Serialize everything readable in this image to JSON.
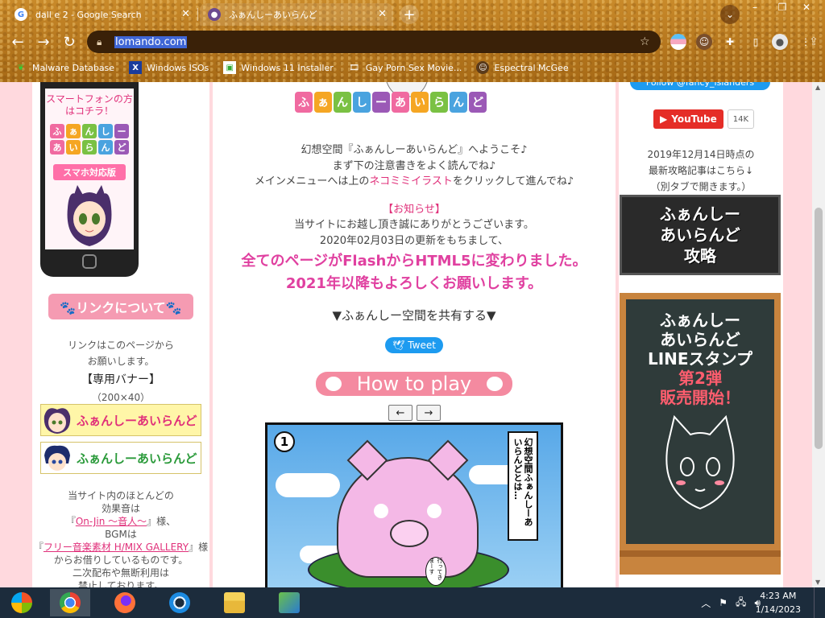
{
  "browser": {
    "tabs": [
      {
        "title": "dall e 2 - Google Search",
        "favicon": "google-icon",
        "active": false
      },
      {
        "title": "ふぁんしーあいらんど",
        "favicon": "cat-girl-icon",
        "active": true
      }
    ],
    "url": "lomando.com",
    "bookmarks": [
      {
        "label": "Malware Database",
        "icon": "leaf-icon"
      },
      {
        "label": "Windows ISOs",
        "icon": "x-icon"
      },
      {
        "label": "Windows 11 Installer",
        "icon": "image-icon"
      },
      {
        "label": "Gay Porn Sex Movie...",
        "icon": "film-icon"
      },
      {
        "label": "Espectral McGee",
        "icon": "person-icon"
      }
    ],
    "window_controls": {
      "minimize": "–",
      "maximize": "❐",
      "close": "✕"
    }
  },
  "left": {
    "phone_caption": "スマートフォンの方はコチラ！",
    "phone_logo_tiles": [
      "ふ",
      "ぁ",
      "ん",
      "し",
      "ー",
      "あ",
      "い",
      "ら",
      "ん",
      "ど"
    ],
    "phone_sp_label": "スマホ対応版",
    "link_button": "🐾リンクについて🐾",
    "link_text_1": "リンクはこのページから",
    "link_text_2": "お願いします。",
    "banner_title": "【専用バナー】",
    "banner_size": "（200×40）",
    "banner_text": "ふぁんしーあいらんど",
    "credit_1": "当サイト内のほとんどの",
    "credit_2": "効果音は",
    "credit_3a": "『",
    "credit_3_link": "On-Jin ～音人～",
    "credit_3b": "』様、",
    "credit_4": "BGMは",
    "credit_5a": "『",
    "credit_5_link": "フリー音楽素材 H/MIX GALLERY",
    "credit_5b": "』様",
    "credit_6": "からお借りしているものです。",
    "credit_7": "二次配布や無断利用は",
    "credit_8": "禁止しております。"
  },
  "main": {
    "logo_tiles": [
      "ふ",
      "ぁ",
      "ん",
      "し",
      "ー",
      "あ",
      "い",
      "ら",
      "ん",
      "ど"
    ],
    "intro_1": "幻想空間『ふぁんしーあいらんど』へようこそ♪",
    "intro_2": "まず下の注意書きをよく読んでね♪",
    "intro_3a": "メインメニューへは上の",
    "intro_3_link": "ネコミミイラスト",
    "intro_3b": "をクリックして進んでね♪",
    "notice_title": "【お知らせ】",
    "notice_1": "当サイトにお越し頂き誠にありがとうございます。",
    "notice_2": "2020年02月03日の更新をもちまして、",
    "big_1": "全てのページがFlashからHTML5に変わりました。",
    "big_2": "2021年以降もよろしくお願いします。",
    "share_text": "▼ふぁんしー空間を共有する▼",
    "tweet_label": "Tweet",
    "howto_label": "How to play",
    "prev_label": "←",
    "next_label": "→",
    "comic": {
      "panel_number": "1",
      "bubble_text": "幻想空間ふぁんしーあいらんどとは…",
      "small_bubble": "行ってきまーす"
    }
  },
  "right": {
    "follow_label": "Follow @fancy_islanders",
    "youtube_label": "YouTube",
    "youtube_count": "14K",
    "update_1": "2019年12月14日時点の",
    "update_2": "最新攻略記事はこちら↓",
    "update_3": "（別タブで開きます。）",
    "kouryaku_1": "ふぁんしー",
    "kouryaku_2": "あいらんど",
    "kouryaku_3": "攻略",
    "board_1": "ふぁんしー",
    "board_2": "あいらんど",
    "board_3": "LINEスタンプ",
    "board_4": "第2弾",
    "board_5": "販売開始！"
  },
  "taskbar": {
    "apps": [
      "start-orb-icon",
      "chrome-icon",
      "firefox-icon",
      "opera-icon",
      "file-explorer-icon",
      "network-app-icon"
    ],
    "time": "4:23 AM",
    "date": "1/14/2023"
  }
}
